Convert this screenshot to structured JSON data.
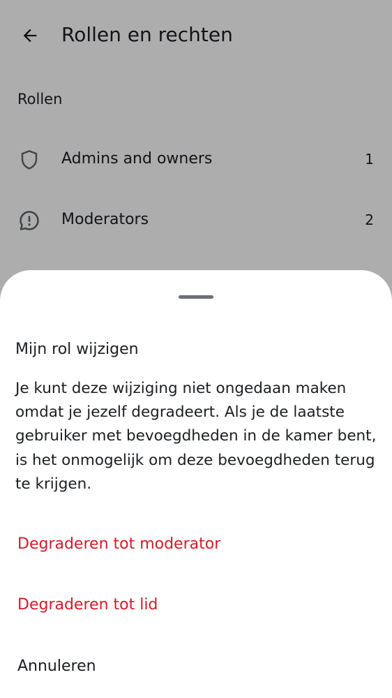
{
  "header": {
    "title": "Rollen en rechten",
    "back_icon": "arrow-left-icon"
  },
  "roles": {
    "section_title": "Rollen",
    "items": [
      {
        "label": "Admins and owners",
        "count": "1",
        "icon": "shield-icon"
      },
      {
        "label": "Moderators",
        "count": "2",
        "icon": "chat-exclamation-icon"
      }
    ]
  },
  "sheet": {
    "title": "Mijn rol wijzigen",
    "body": "Je kunt deze wijziging niet ongedaan maken omdat je jezelf degradeert. Als je de laatste gebruiker met bevoegdheden in de kamer bent, is het onmogelijk om deze bevoegdheden terug te krijgen.",
    "actions": [
      {
        "label": "Degraderen tot moderator"
      },
      {
        "label": "Degraderen tot lid"
      },
      {
        "label": "Annuleren"
      }
    ]
  },
  "colors": {
    "destructive": "#d51928",
    "text_primary": "#1b1d22",
    "scrim": "rgba(0,0,0,0.32)"
  }
}
